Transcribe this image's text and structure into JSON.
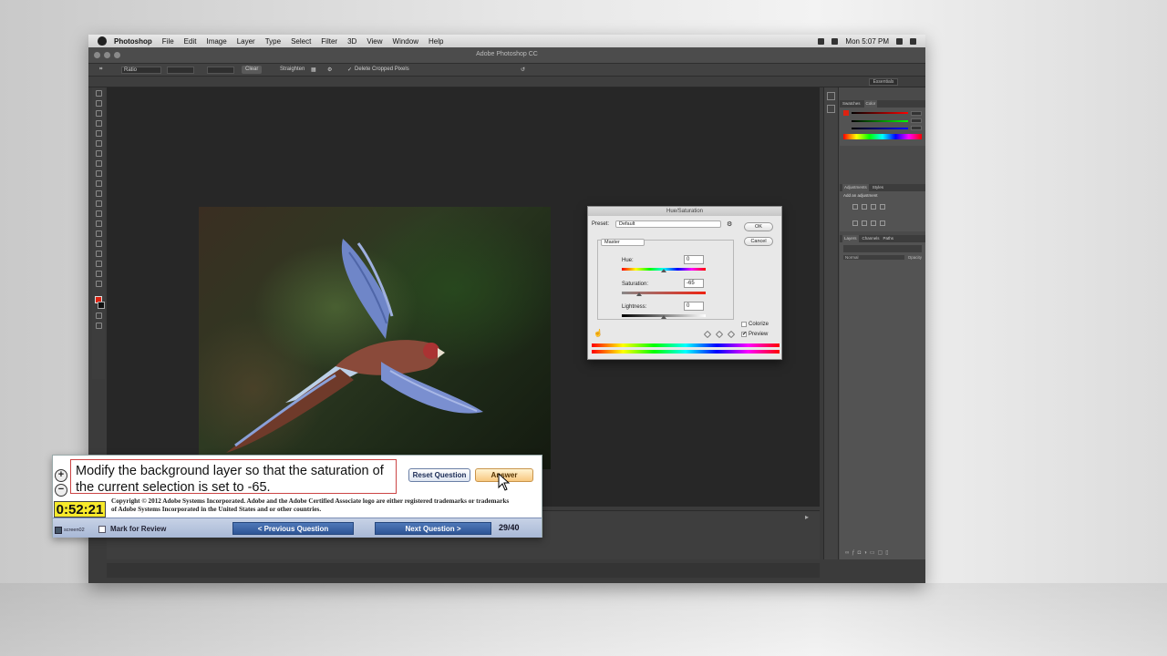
{
  "menubar": {
    "app": "Photoshop",
    "items": [
      "File",
      "Edit",
      "Image",
      "Layer",
      "Type",
      "Select",
      "Filter",
      "3D",
      "View",
      "Window",
      "Help"
    ],
    "clock": "Mon 5:07 PM"
  },
  "window": {
    "title": "Adobe Photoshop CC"
  },
  "options": {
    "ratio": "Ratio",
    "clear": "Clear",
    "straighten": "Straighten",
    "delete_cropped": "Delete Cropped Pixels",
    "workspace": "Essentials"
  },
  "panels": {
    "swatch_tabs": [
      "Swatches",
      "Color"
    ],
    "adjust_tabs": [
      "Adjustments",
      "Styles"
    ],
    "add_adjustment": "Add an adjustment",
    "layer_tabs": [
      "Layers",
      "Channels",
      "Paths"
    ],
    "layer_kind": "Normal",
    "opacity": "Opacity"
  },
  "dialog": {
    "title": "Hue/Saturation",
    "preset_label": "Preset:",
    "preset_value": "Default",
    "channel": "Master",
    "ok": "OK",
    "cancel": "Cancel",
    "hue_label": "Hue:",
    "hue_value": "0",
    "sat_label": "Saturation:",
    "sat_value": "-65",
    "light_label": "Lightness:",
    "light_value": "0",
    "colorize": "Colorize",
    "preview": "Preview",
    "preview_checked": "✔"
  },
  "exam": {
    "question": "Modify the background layer so that the saturation of the current selection is set to -65.",
    "reset": "Reset Question",
    "answer": "Answer",
    "timer": "0:52:21",
    "copyright": "Copyright © 2012 Adobe Systems Incorporated. Adobe and the Adobe Certified Associate logo are either registered trademarks or trademarks of Adobe Systems Incorporated in the United States and or other countries.",
    "screen_label": "screen02",
    "mark": "Mark for Review",
    "prev": "< Previous Question",
    "next": "Next Question >",
    "progress": "29/40"
  },
  "colors": {
    "exam_timer": "#f8ea2a",
    "nav_button": "#2e5596",
    "answer_button": "#f8c880",
    "foreground_swatch": "#dd2211"
  }
}
